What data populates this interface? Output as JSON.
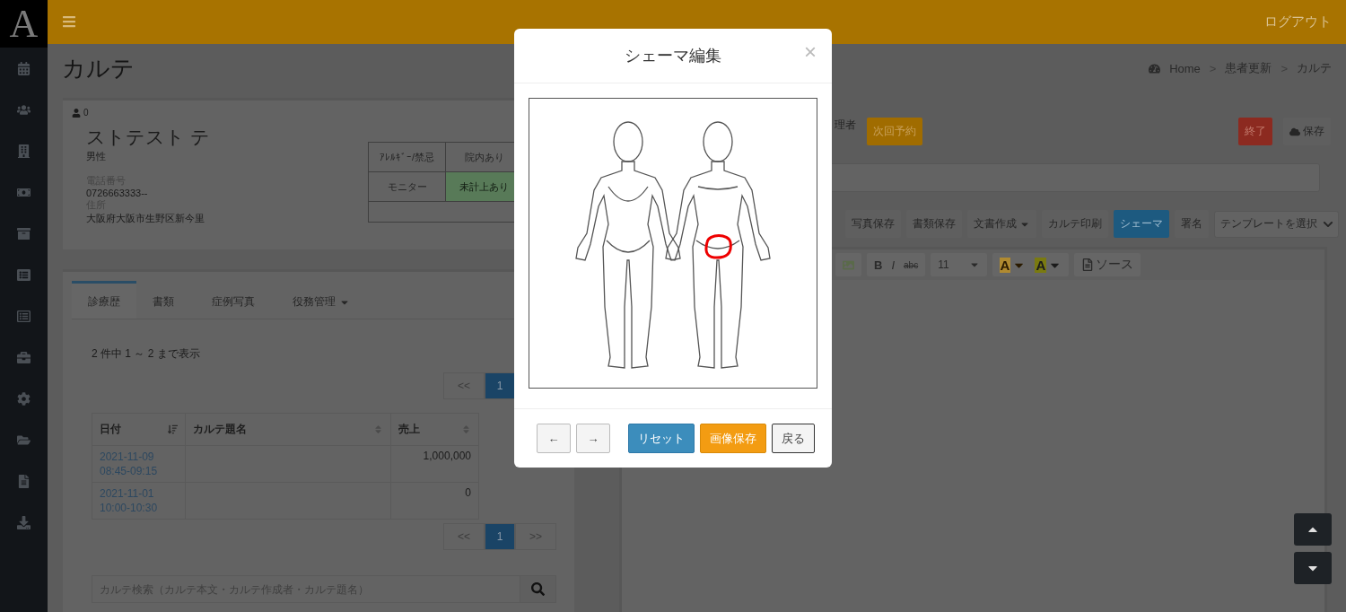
{
  "logo": "A",
  "topbar": {
    "logout": "ログアウト"
  },
  "page": {
    "title": "カルテ",
    "breadcrumb": [
      "Home",
      "患者更新",
      "カルテ"
    ],
    "breadcrumb_separator": ">"
  },
  "patient": {
    "id": "0",
    "name": "ストテスト テ",
    "gender": "男性",
    "phone_label": "電話番号",
    "phone": "0726663333--",
    "address_label": "住所",
    "address": "大阪府大阪市生野区新今里",
    "flags": [
      {
        "label": "ｱﾚﾙｷﾞｰ/禁忌",
        "value": "院内あり",
        "highlight": false
      },
      {
        "label": "モニター",
        "value": "未計上あり",
        "highlight": true
      }
    ]
  },
  "tabs": [
    {
      "label": "診療歴",
      "selected": true,
      "dropdown": false
    },
    {
      "label": "書類",
      "selected": false,
      "dropdown": false
    },
    {
      "label": "症例写真",
      "selected": false,
      "dropdown": false
    },
    {
      "label": "役務管理",
      "selected": false,
      "dropdown": true
    }
  ],
  "history": {
    "summary": "2 件中 1 ～ 2 まで表示",
    "pagination_top": [
      {
        "label": "<<",
        "selected": false
      },
      {
        "label": "1",
        "selected": true
      }
    ],
    "columns": [
      "日付",
      "カルテ題名",
      "売上"
    ],
    "rows": [
      {
        "date": "2021-11-09",
        "time": "08:45-09:15",
        "title_text": "",
        "sales": "1,000,000"
      },
      {
        "date": "2021-11-01",
        "time": "10:00-10:30",
        "title_text": "",
        "sales": "0"
      }
    ],
    "pagination_bottom": [
      {
        "label": "<<",
        "selected": false
      },
      {
        "label": "1",
        "selected": true
      },
      {
        "label": ">>",
        "selected": false
      }
    ],
    "search_placeholder": "カルテ検索（カルテ本文・カルテ作成者・カルテ題名）"
  },
  "record": {
    "role_text": "理者",
    "next_button": "次回予約",
    "end_button": "終了",
    "save_button": "保存",
    "toolbar": [
      {
        "label": "写真保存",
        "selected": false,
        "dropdown": false
      },
      {
        "label": "書類保存",
        "selected": false,
        "dropdown": false
      },
      {
        "label": "文書作成",
        "selected": false,
        "dropdown": true
      },
      {
        "label": "カルテ印刷",
        "selected": false,
        "dropdown": false
      },
      {
        "label": "シェーマ",
        "selected": true,
        "dropdown": false
      },
      {
        "label": "署名",
        "selected": false,
        "dropdown": false
      }
    ],
    "template_select": "テンプレートを選択",
    "editor": {
      "bold": "B",
      "italic": "I",
      "strike": "abc",
      "font_size": "11",
      "font_color": "A",
      "bg_color": "A",
      "source": "ソース"
    }
  },
  "modal": {
    "title": "シェーマ編集",
    "close": "×",
    "prev": "←",
    "next": "→",
    "reset": "リセット",
    "save_image": "画像保存",
    "back": "戻る"
  }
}
